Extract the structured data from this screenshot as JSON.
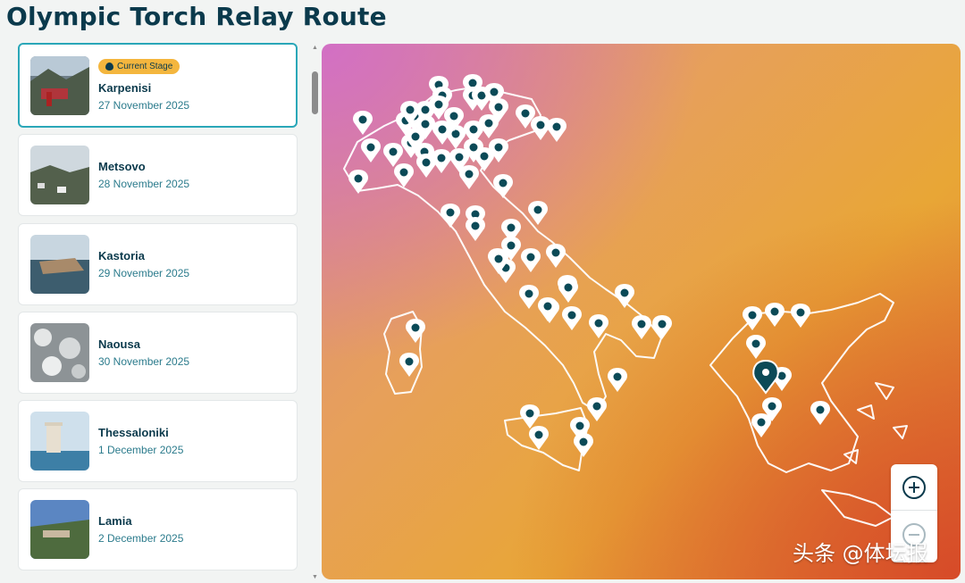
{
  "page_title": "Olympic Torch Relay Route",
  "badge_label": "Current Stage",
  "stages": [
    {
      "city": "Karpenisi",
      "date": "27 November 2025",
      "current": true
    },
    {
      "city": "Metsovo",
      "date": "28 November 2025",
      "current": false
    },
    {
      "city": "Kastoria",
      "date": "29 November 2025",
      "current": false
    },
    {
      "city": "Naousa",
      "date": "30 November 2025",
      "current": false
    },
    {
      "city": "Thessaloniki",
      "date": "1 December 2025",
      "current": false
    },
    {
      "city": "Lamia",
      "date": "2 December 2025",
      "current": false
    }
  ],
  "map": {
    "zoom_in_icon": "plus-circle-icon",
    "zoom_out_icon": "minus-circle-icon",
    "marker_icon": "map-pin-icon",
    "current_marker_icon": "flame-pin-icon",
    "colors": {
      "pin": "#ffffff",
      "pin_dot": "#0b4a57",
      "current_pin": "#0b4a57",
      "outline": "#ffffff"
    }
  },
  "watermark": "头条 @体坛报"
}
